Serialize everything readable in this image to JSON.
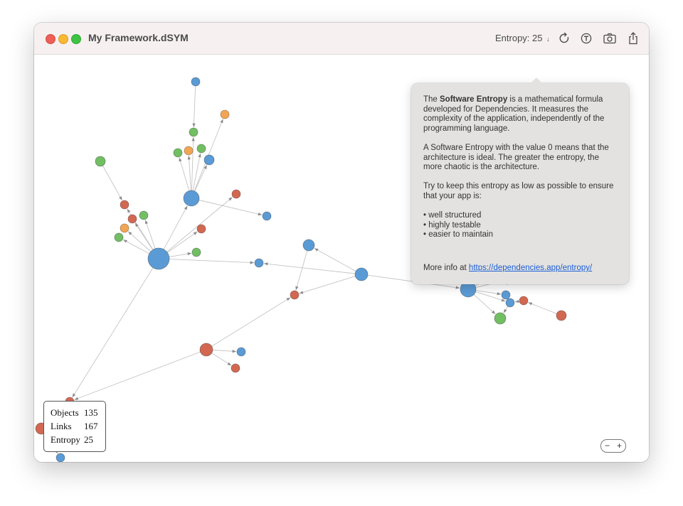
{
  "window": {
    "title": "My Framework.dSYM"
  },
  "toolbar": {
    "entropy_label": "Entropy: 25",
    "entropy_arrow": "↓",
    "icons": [
      "refresh-icon",
      "text-icon",
      "camera-icon",
      "share-icon"
    ]
  },
  "popover": {
    "p1_pre": "The ",
    "p1_bold": "Software Entropy",
    "p1_post": " is a mathematical formula developed for Dependencies. It measures the complexity of the application, independently of the programming language.",
    "p2": "A Software Entropy with the value 0 means that the architecture is ideal. The greater the entropy, the more chaotic is the architecture.",
    "p3": "Try to keep this entropy as low as possible to ensure that your app is:",
    "bullets": [
      "well structured",
      "highly testable",
      "easier to maintain"
    ],
    "more_prefix": "More info at ",
    "link_text": "https://dependencies.app/entropy/"
  },
  "stats": {
    "objects_label": "Objects",
    "objects_value": "135",
    "links_label": "Links",
    "links_value": "167",
    "entropy_label": "Entropy",
    "entropy_value": "25"
  },
  "zoom": {
    "minus": "−",
    "plus": "+"
  },
  "colors": {
    "blue": "#5b9bd5",
    "red": "#d26852",
    "green": "#72bf63",
    "orange": "#f2a653",
    "edge": "#c4c4c4",
    "arrow": "#8c8c8c",
    "link": "#1a5fd6"
  }
}
